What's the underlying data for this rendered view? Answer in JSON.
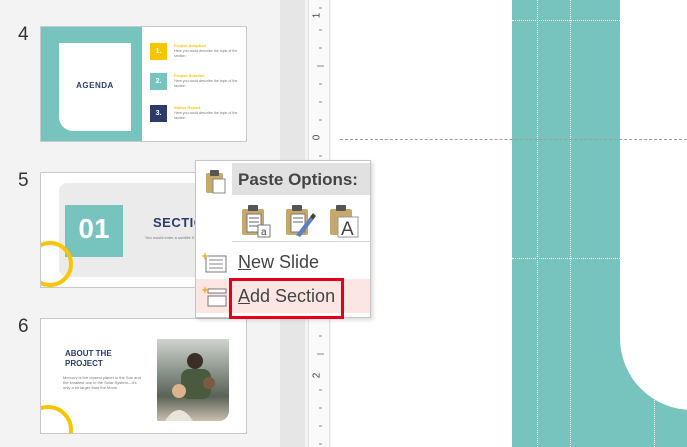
{
  "slides": [
    {
      "number": "4",
      "title": "AGENDA",
      "items": [
        {
          "num": "1.",
          "title": "Project Adoption",
          "desc": "Here you could describe the topic of the section",
          "color": "#f9c500"
        },
        {
          "num": "2.",
          "title": "Project Solution",
          "desc": "Here you could describe the topic of the section",
          "color": "#77c3bd"
        },
        {
          "num": "3.",
          "title": "Status Report",
          "desc": "Here you could describe the topic of the section",
          "color": "#2c3b6a"
        }
      ]
    },
    {
      "number": "5",
      "big_number": "01",
      "title": "SECTION",
      "desc": "You would enter a subtitle if you need it"
    },
    {
      "number": "6",
      "title": "ABOUT THE PROJECT",
      "desc": "Mercury is the closest planet to the Sun and the smallest one in the Solar System—it's only a bit larger than the Moon"
    }
  ],
  "ruler": {
    "labels": [
      "1",
      "0",
      "1",
      "2"
    ]
  },
  "context_menu": {
    "header": "Paste Options:",
    "paste_options": [
      "paste-keep-source-icon",
      "paste-merge-format-icon",
      "paste-text-only-icon"
    ],
    "items": [
      {
        "label_underline": "N",
        "label_rest": "ew Slide"
      },
      {
        "label_underline": "A",
        "label_rest": "dd Section"
      }
    ]
  },
  "colors": {
    "teal": "#77c3bd",
    "yellow": "#f9c500",
    "navy": "#2c3b6a",
    "highlight": "#e0001b"
  }
}
